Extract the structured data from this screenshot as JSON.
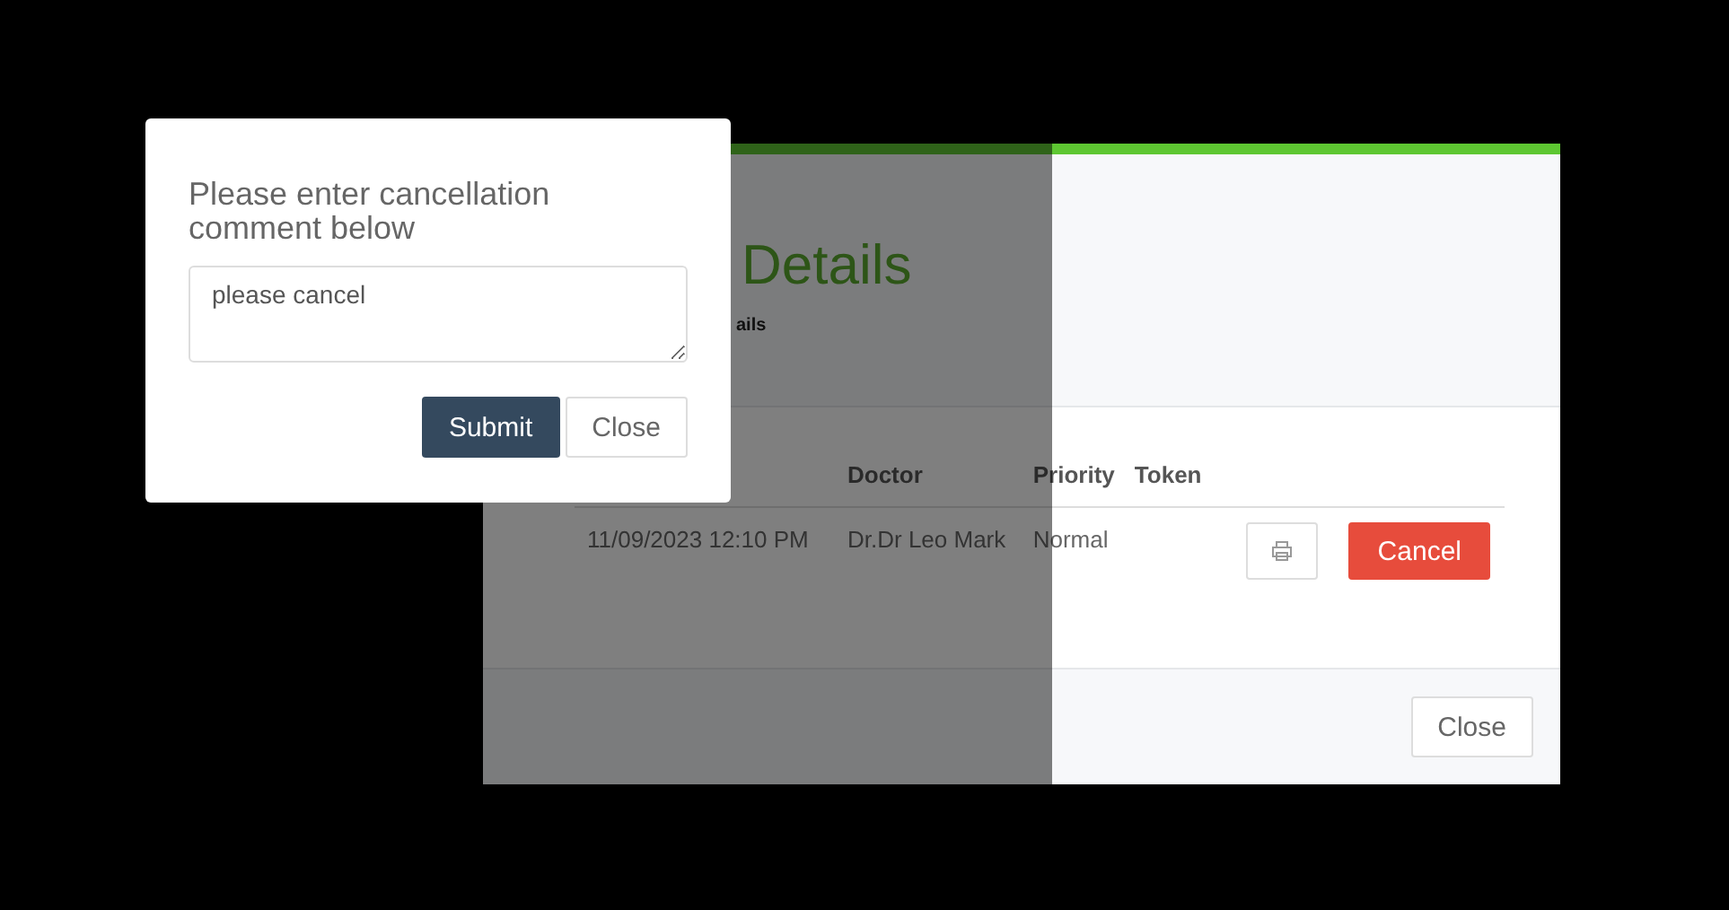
{
  "details_modal": {
    "title": "Details",
    "subtitle": "ails",
    "table": {
      "columns": [
        {},
        {
          "label": "Doctor"
        },
        {
          "label": "Priority"
        },
        {
          "label": "Token"
        }
      ],
      "rows": [
        {
          "cells": [
            "11/09/2023 12:10 PM",
            "Dr.Dr Leo Mark",
            "Normal"
          ],
          "action": "Cancel"
        }
      ]
    },
    "footer_button": "Close"
  },
  "cancel_dialog": {
    "title": "Please enter cancellation comment below",
    "comment": {
      "value": "please cancel"
    },
    "buttons": [
      {
        "label": "Submit",
        "kind": "primary"
      },
      {
        "label": "Close",
        "kind": "default"
      }
    ]
  }
}
